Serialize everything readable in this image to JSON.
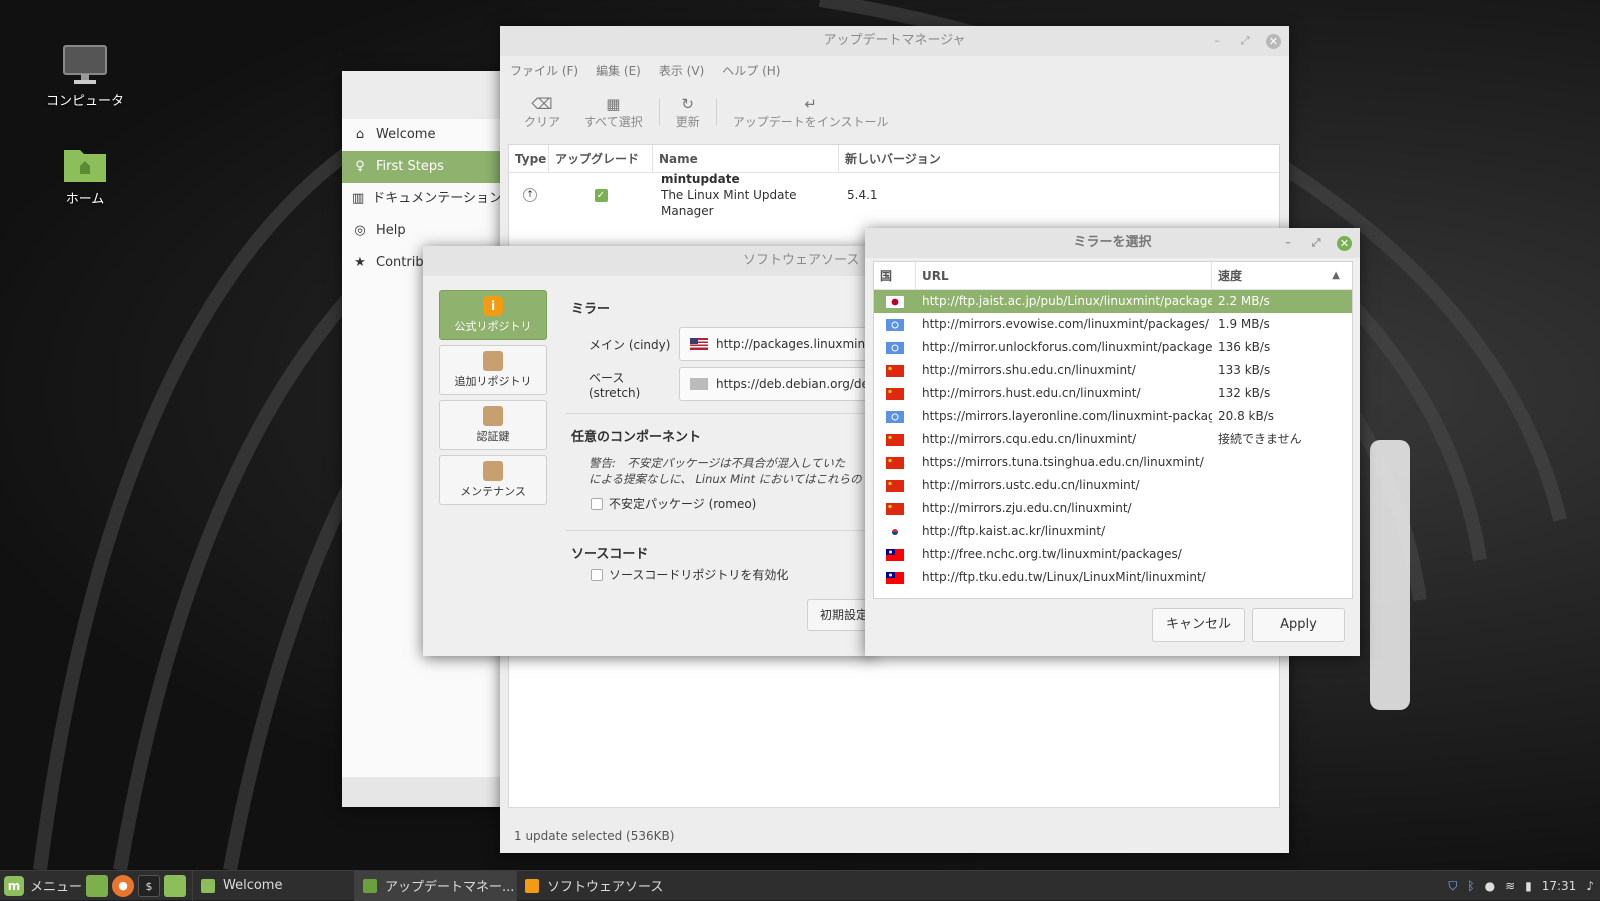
{
  "desktop": {
    "icons": [
      {
        "label": "コンピュータ"
      },
      {
        "label": "ホーム"
      }
    ]
  },
  "welcome": {
    "items": [
      {
        "label": "Welcome",
        "icon": "home-icon"
      },
      {
        "label": "First Steps",
        "icon": "lightbulb-icon",
        "active": true
      },
      {
        "label": "ドキュメンテーション",
        "icon": "book-icon"
      },
      {
        "label": "Help",
        "icon": "lifebuoy-icon"
      },
      {
        "label": "Contribut",
        "icon": "star-icon"
      }
    ]
  },
  "update_manager": {
    "title": "アップデートマネージャ",
    "menu": [
      "ファイル (F)",
      "編集 (E)",
      "表示 (V)",
      "ヘルプ (H)"
    ],
    "toolbar": {
      "clear": "クリア",
      "select_all": "すべて選択",
      "refresh": "更新",
      "install": "アップデートをインストール"
    },
    "columns": [
      "Type",
      "アップグレード",
      "Name",
      "新しいバージョン"
    ],
    "rows": [
      {
        "name": "mintupdate",
        "desc": "The Linux Mint Update Manager",
        "version": "5.4.1",
        "checked": true
      }
    ],
    "status": "1 update selected (536KB)"
  },
  "software_sources": {
    "title": "ソフトウェアソース",
    "sidebar": [
      "公式リポジトリ",
      "追加リポジトリ",
      "認証鍵",
      "メンテナンス"
    ],
    "mirrors_heading": "ミラー",
    "main_label": "メイン (cindy)",
    "main_value": "http://packages.linuxmint.c",
    "base_label": "ベース (stretch)",
    "base_value": "https://deb.debian.org/debi",
    "optional_heading": "任意のコンポーネント",
    "warning_line1": "警告:　不安定パッケージは不具合が混入していた",
    "warning_line2": "による提案なしに、 Linux Mint においてはこれらの",
    "unstable_label": "不安定パッケージ (romeo)",
    "source_heading": "ソースコード",
    "source_label": "ソースコードリポジトリを有効化",
    "reset_label": "初期設定"
  },
  "mirror_chooser": {
    "title": "ミラーを選択",
    "columns": [
      "国",
      "URL",
      "速度"
    ],
    "rows": [
      {
        "flag": "jp",
        "url": "http://ftp.jaist.ac.jp/pub/Linux/linuxmint/packages/",
        "speed": "2.2 MB/s",
        "selected": true
      },
      {
        "flag": "un",
        "url": "http://mirrors.evowise.com/linuxmint/packages/",
        "speed": "1.9 MB/s"
      },
      {
        "flag": "un",
        "url": "http://mirror.unlockforus.com/linuxmint/packages/",
        "speed": "136 kB/s"
      },
      {
        "flag": "cn",
        "url": "http://mirrors.shu.edu.cn/linuxmint/",
        "speed": "133 kB/s"
      },
      {
        "flag": "cn",
        "url": "http://mirrors.hust.edu.cn/linuxmint/",
        "speed": "132 kB/s"
      },
      {
        "flag": "un",
        "url": "https://mirrors.layeronline.com/linuxmint-packages/",
        "speed": "20.8 kB/s"
      },
      {
        "flag": "cn",
        "url": "http://mirrors.cqu.edu.cn/linuxmint/",
        "speed": "接続できません"
      },
      {
        "flag": "cn",
        "url": "https://mirrors.tuna.tsinghua.edu.cn/linuxmint/",
        "speed": ""
      },
      {
        "flag": "cn",
        "url": "http://mirrors.ustc.edu.cn/linuxmint/",
        "speed": ""
      },
      {
        "flag": "cn",
        "url": "http://mirrors.zju.edu.cn/linuxmint/",
        "speed": ""
      },
      {
        "flag": "kr",
        "url": "http://ftp.kaist.ac.kr/linuxmint/",
        "speed": ""
      },
      {
        "flag": "tw",
        "url": "http://free.nchc.org.tw/linuxmint/packages/",
        "speed": ""
      },
      {
        "flag": "tw",
        "url": "http://ftp.tku.edu.tw/Linux/LinuxMint/linuxmint/",
        "speed": ""
      }
    ],
    "cancel": "キャンセル",
    "apply": "Apply"
  },
  "panel": {
    "menu_label": "メニュー",
    "tasks": [
      "Welcome",
      "アップデートマネー...",
      "ソフトウェアソース"
    ],
    "clock": "17:31"
  },
  "colors": {
    "accent": "#8fb36e",
    "panel": "#2e2e2e",
    "close_green": "#7aaf53"
  }
}
